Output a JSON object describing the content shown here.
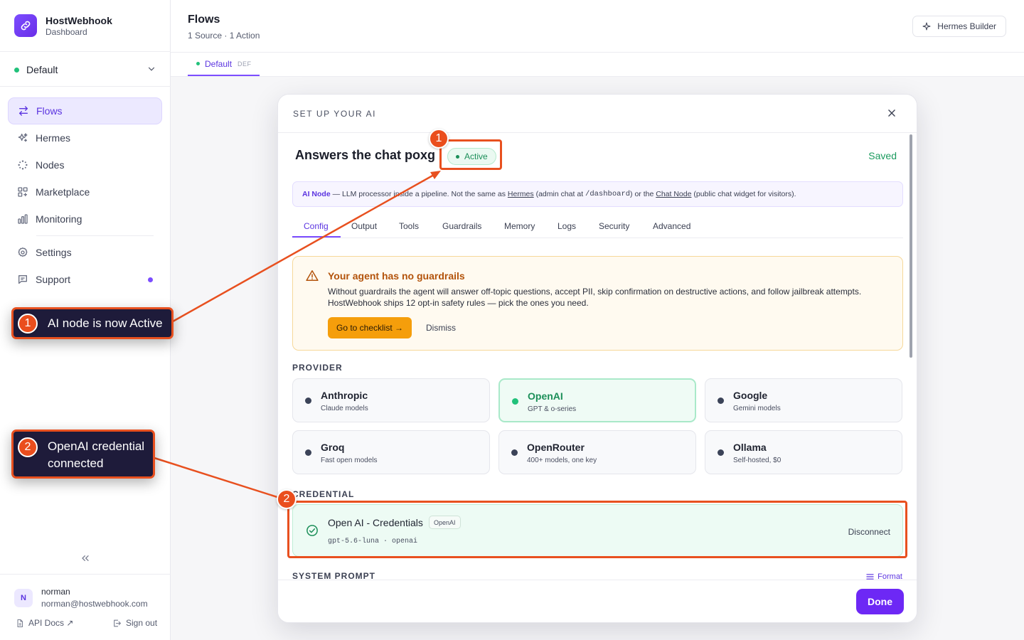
{
  "brand": {
    "name": "HostWebhook",
    "subtitle": "Dashboard"
  },
  "workspace": {
    "label": "Default"
  },
  "nav": {
    "flows": "Flows",
    "hermes": "Hermes",
    "nodes": "Nodes",
    "marketplace": "Marketplace",
    "monitoring": "Monitoring",
    "settings": "Settings",
    "support": "Support"
  },
  "user": {
    "initial": "N",
    "name": "norman",
    "email": "norman@hostwebhook.com"
  },
  "footer": {
    "api_docs": "API Docs ↗",
    "sign_out": "Sign out"
  },
  "header": {
    "title": "Flows",
    "subtitle": "1 Source · 1 Action",
    "builder_button": "Hermes Builder"
  },
  "flow_tab": {
    "label": "Default",
    "badge": "DEF"
  },
  "modal": {
    "title": "SET UP YOUR AI",
    "node_title": "Answers the chat poxg",
    "status": "Active",
    "saved": "Saved",
    "info": {
      "lead": "AI Node",
      "t1": " — LLM processor inside a pipeline. Not the same as ",
      "link1": "Hermes",
      "t2": " (admin chat at ",
      "code": "/dashboard",
      "t3": ") or the ",
      "link2": "Chat Node",
      "t4": " (public chat widget for visitors)."
    },
    "tabs": [
      "Config",
      "Output",
      "Tools",
      "Guardrails",
      "Memory",
      "Logs",
      "Security",
      "Advanced"
    ],
    "warning": {
      "title": "Your agent has no guardrails",
      "line1": "Without guardrails the agent will answer off-topic questions, accept PII, skip confirmation on destructive actions, and follow jailbreak attempts.",
      "line2": "HostWebhook ships 12 opt-in safety rules — pick the ones you need.",
      "cta": "Go to checklist →",
      "dismiss": "Dismiss"
    },
    "provider_label": "PROVIDER",
    "providers": [
      {
        "name": "Anthropic",
        "sub": "Claude models"
      },
      {
        "name": "OpenAI",
        "sub": "GPT & o-series"
      },
      {
        "name": "Google",
        "sub": "Gemini models"
      },
      {
        "name": "Groq",
        "sub": "Fast open models"
      },
      {
        "name": "OpenRouter",
        "sub": "400+ models, one key"
      },
      {
        "name": "Ollama",
        "sub": "Self-hosted, $0"
      }
    ],
    "selected_provider": "OpenAI",
    "credential_label": "CREDENTIAL",
    "credential": {
      "name": "Open AI - Credentials",
      "tag": "OpenAI",
      "meta": "gpt-5.6-luna · openai",
      "action": "Disconnect"
    },
    "system_prompt_label": "SYSTEM PROMPT",
    "format": "Format",
    "done": "Done"
  },
  "annotations": {
    "c1": {
      "num": "1",
      "text": "AI node is now Active"
    },
    "c2": {
      "num": "2",
      "line1": "OpenAI credential",
      "line2": "connected"
    }
  },
  "colors": {
    "accent": "#6d28f5",
    "success": "#21c17a",
    "warning": "#f59e0b",
    "annotation": "#e8501f"
  }
}
